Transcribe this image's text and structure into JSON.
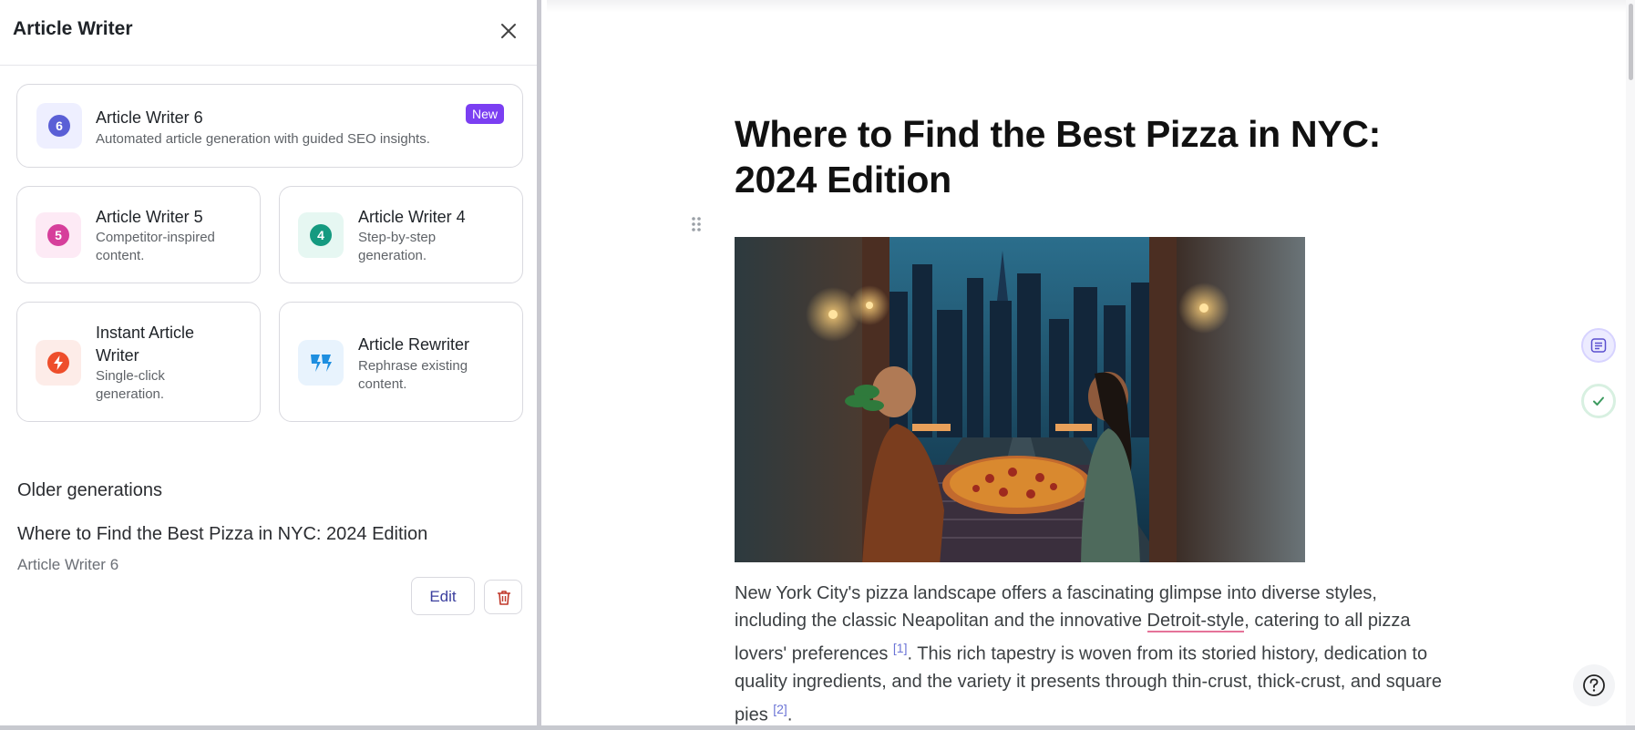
{
  "sidebar": {
    "title": "Article Writer",
    "cards": [
      {
        "number": "6",
        "title": "Article Writer 6",
        "desc": "Automated article generation with guided SEO insights.",
        "badge": "New",
        "color": "#5a5fd6",
        "bg": "#eeefff"
      },
      {
        "number": "5",
        "title": "Article Writer 5",
        "desc": "Competitor-inspired content.",
        "color": "#d63f9b",
        "bg": "#fdeaf5"
      },
      {
        "number": "4",
        "title": "Article Writer 4",
        "desc": "Step-by-step generation.",
        "color": "#159a80",
        "bg": "#e6f7f2"
      },
      {
        "title": "Instant Article Writer",
        "desc": "Single-click generation.",
        "icon": "lightning-icon",
        "color": "#ee4e2b",
        "bg": "#fdece8"
      },
      {
        "title": "Article Rewriter",
        "desc": "Rephrase existing content.",
        "icon": "rewrite-icon",
        "color": "#1f8fe0",
        "bg": "#e8f3fd"
      }
    ],
    "older": {
      "heading": "Older generations",
      "item_title": "Where to Find the Best Pizza in NYC: 2024 Edition",
      "item_sub": "Article Writer 6",
      "edit_label": "Edit"
    }
  },
  "main": {
    "title": "Where to Find the Best Pizza in NYC: 2024 Edition",
    "para": {
      "t1": "New York City's pizza landscape offers a fascinating glimpse into diverse styles, including the classic Neapolitan and the innovative ",
      "link": "Detroit-style",
      "t2": ", catering to all pizza lovers' preferences ",
      "ref1": "[1]",
      "t3": ". This rich tapestry is woven from its storied history, dedication to quality ingredients, and the variety it presents through thin-crust, thick-crust, and square pies ",
      "ref2": "[2]",
      "t4": "."
    }
  },
  "icons": {
    "close": "close-icon",
    "trash": "trash-icon",
    "drag": "drag-handle-icon",
    "outline": "outline-icon",
    "check": "check-icon",
    "help": "help-icon"
  }
}
